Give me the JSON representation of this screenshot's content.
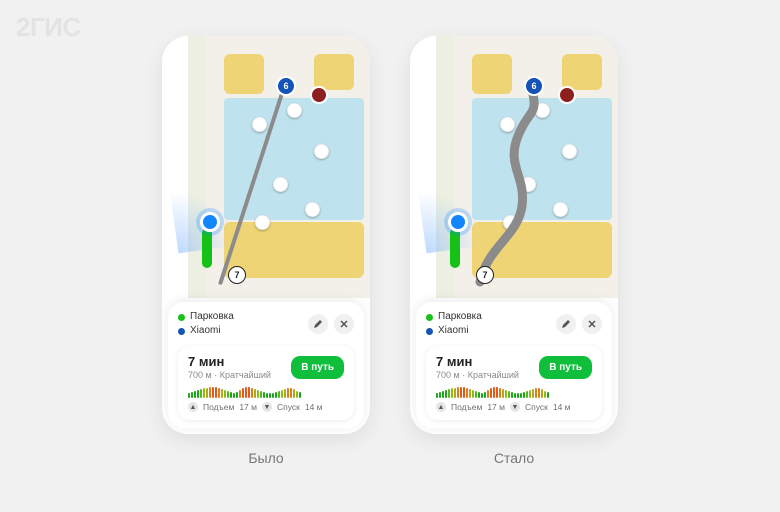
{
  "brand": "2ГИС",
  "phones": {
    "before": {
      "caption": "Было",
      "marker_start": "6",
      "marker_end": "7",
      "endpoints": {
        "from": "Парковка",
        "to": "Xiaomi"
      },
      "route": {
        "duration": "7 мин",
        "sub": "700 м · Кратчайший",
        "go_label": "В путь",
        "ascent_label": "Подъем",
        "ascent_value": "17 м",
        "descent_label": "Спуск",
        "descent_value": "14 м"
      }
    },
    "after": {
      "caption": "Стало",
      "marker_start": "6",
      "marker_end": "7",
      "endpoints": {
        "from": "Парковка",
        "to": "Xiaomi"
      },
      "route": {
        "duration": "7 мин",
        "sub": "700 м · Кратчайший",
        "go_label": "В путь",
        "ascent_label": "Подъем",
        "ascent_value": "17 м",
        "descent_label": "Спуск",
        "descent_value": "14 м"
      }
    }
  },
  "elevation_bars": {
    "colors": [
      "#1aa51a",
      "#1aa51a",
      "#1aa51a",
      "#1aa51a",
      "#58b51a",
      "#8abf1a",
      "#b9a51a",
      "#d8801a",
      "#e5581a",
      "#e5581a",
      "#d8801a",
      "#b9a51a",
      "#8abf1a",
      "#58b51a",
      "#1aa51a",
      "#1aa51a",
      "#1aa51a",
      "#d8801a",
      "#e5581a",
      "#e5581a",
      "#e5581a",
      "#d8801a",
      "#b9a51a",
      "#8abf1a",
      "#58b51a",
      "#1aa51a",
      "#1aa51a",
      "#1aa51a",
      "#1aa51a",
      "#1aa51a",
      "#58b51a",
      "#8abf1a",
      "#b9a51a",
      "#d8801a",
      "#d8801a",
      "#b9a51a",
      "#8abf1a",
      "#1aa51a"
    ],
    "heights": [
      5,
      6,
      7,
      8,
      9,
      10,
      10,
      11,
      11,
      11,
      10,
      9,
      8,
      7,
      6,
      5,
      6,
      8,
      10,
      11,
      11,
      10,
      9,
      8,
      7,
      6,
      5,
      5,
      5,
      6,
      7,
      8,
      9,
      10,
      10,
      9,
      7,
      6
    ]
  }
}
